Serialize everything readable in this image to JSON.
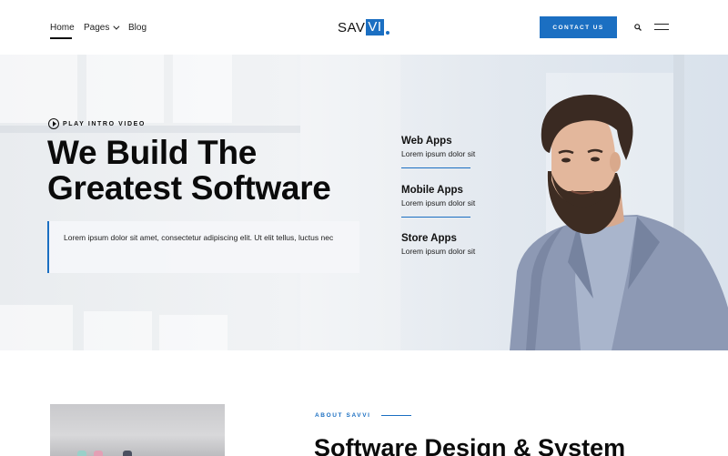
{
  "nav": {
    "items": [
      {
        "label": "Home"
      },
      {
        "label": "Pages"
      },
      {
        "label": "Blog"
      }
    ],
    "logo_part1": "SAV",
    "logo_part2": "VI",
    "contact_label": "CONTACT US"
  },
  "hero": {
    "play_label": "PLAY INTRO VIDEO",
    "title_line1": "We Build The",
    "title_line2": "Greatest Software",
    "quote": "Lorem ipsum dolor sit amet, consectetur adipiscing elit. Ut elit tellus, luctus nec",
    "services": [
      {
        "title": "Web Apps",
        "desc": "Lorem ipsum dolor sit"
      },
      {
        "title": "Mobile Apps",
        "desc": "Lorem ipsum dolor sit"
      },
      {
        "title": "Store Apps",
        "desc": "Lorem ipsum dolor sit"
      }
    ]
  },
  "about": {
    "label": "ABOUT SAVVI",
    "title": "Software Design & System"
  },
  "colors": {
    "accent": "#1b6fc2"
  }
}
